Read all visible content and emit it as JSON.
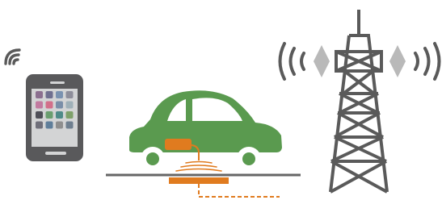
{
  "colors": {
    "phone_body": "#59595b",
    "phone_screen": "#d3d4d5",
    "wifi": "#5a5a5a",
    "car_body": "#5a9a4f",
    "car_window": "#ffffff",
    "wheel": "#ffffff",
    "wheel_hub": "#5a9a4f",
    "ground": "#666666",
    "charger": "#e07b1f",
    "tower": "#5a5a5a",
    "tower_panel": "#b9b9b9",
    "radio_wave": "#5a5a5a"
  },
  "icons": {
    "phone": "smartphone-icon",
    "wifi": "wifi-icon",
    "car": "electric-car-icon",
    "charging": "wireless-charging-pad-icon",
    "tower": "cell-tower-icon"
  },
  "phone_apps": [
    "#8b6f8f",
    "#6f6f8f",
    "#7a92b0",
    "#8e8e9a",
    "#c27aa0",
    "#d26f8a",
    "#7a8ea8",
    "#9fb0b8",
    "#4f4f58",
    "#6a9e6f",
    "#4f8a88",
    "#7ea06a",
    "#6f6f7a",
    "#5f7e9a",
    "#8e8e8e",
    "#6f7f8f"
  ]
}
